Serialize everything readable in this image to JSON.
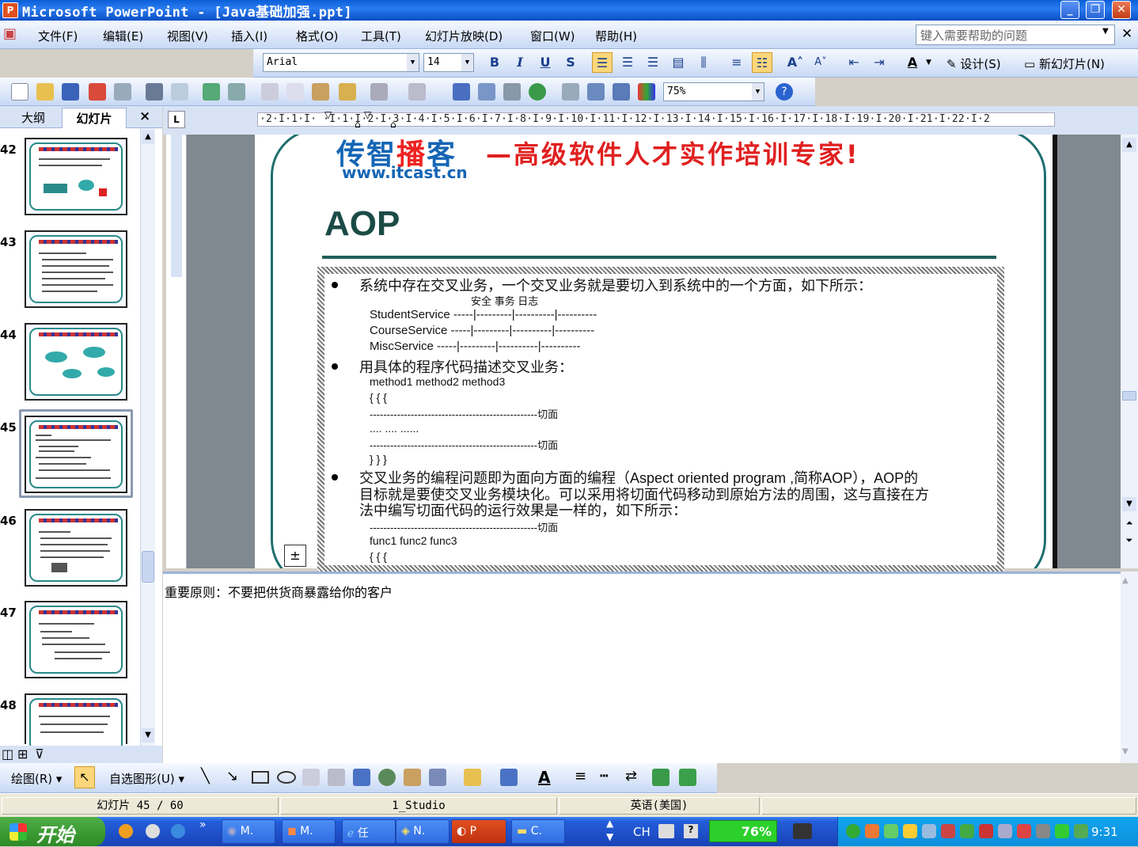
{
  "window": {
    "title": "Microsoft PowerPoint - [Java基础加强.ppt]",
    "app_icon": "powerpoint-icon"
  },
  "menu": {
    "items": [
      "文件(F)",
      "编辑(E)",
      "视图(V)",
      "插入(I)",
      "格式(O)",
      "工具(T)",
      "幻灯片放映(D)",
      "窗口(W)",
      "帮助(H)"
    ],
    "help_placeholder": "键入需要帮助的问题"
  },
  "format_toolbar": {
    "font": "Arial",
    "size": "14",
    "design_label": "设计(S)",
    "new_slide_label": "新幻灯片(N)"
  },
  "standard_toolbar": {
    "zoom": "75%"
  },
  "pane": {
    "tab_outline": "大纲",
    "tab_slides": "幻灯片",
    "close": "×",
    "thumbs": [
      {
        "num": "42"
      },
      {
        "num": "43"
      },
      {
        "num": "44"
      },
      {
        "num": "45",
        "selected": true
      },
      {
        "num": "46"
      },
      {
        "num": "47"
      },
      {
        "num": "48"
      }
    ]
  },
  "ruler": {
    "marks": "·2·I·1·I·  ·I·1·I·2·I·3·I·4·I·5·I·6·I·7·I·8·I·9·I·10·I·11·I·12·I·13·I·14·I·15·I·16·I·17·I·18·I·19·I·20·I·21·I·22·I·2"
  },
  "slide": {
    "brand": {
      "c1": "传智",
      "c2": "播",
      "c3": "客",
      "url": "www.itcast.cn"
    },
    "slogan": "—高级软件人才实作培训专家!",
    "title": "AOP",
    "bullets": [
      "系统中存在交叉业务，一个交叉业务就是要切入到系统中的一个方面，如下所示：",
      "用具体的程序代码描述交叉业务：",
      "交叉业务的编程问题即为面向方面的编程（Aspect oriented program ,简称AOP），AOP的",
      "目标就是要使交叉业务模块化。可以采用将切面代码移动到原始方法的周围，这与直接在方",
      "法中编写切面代码的运行效果是一样的，如下所示："
    ],
    "cols_header": "安全       事务        日志",
    "services": [
      "StudentService  -----|---------|----------|----------",
      "CourseService   -----|---------|----------|----------",
      "MiscService      -----|---------|----------|----------"
    ],
    "methods": "method1          method2          method3",
    "braces_open": "{                      {                       {",
    "cut_line": "-------------------------------------------------切面",
    "dots": "....             ....                ......",
    "braces_close": "}                      }                       }",
    "funcs": "func1          func2           func3",
    "braces3": "{              {                 {"
  },
  "notes": {
    "text": "重要原则：不要把供货商暴露给你的客户"
  },
  "drawing_toolbar": {
    "draw_label": "绘图(R)",
    "autoshape_label": "自选图形(U)"
  },
  "status": {
    "slide": "幻灯片 45 / 60",
    "design": "1_Studio",
    "lang": "英语(美国)"
  },
  "taskbar": {
    "start": "开始",
    "tasks": [
      "M.",
      "M.",
      "任",
      "N.",
      "P",
      "C."
    ],
    "lang": "CH",
    "battery": "76%",
    "clock": "9:31"
  },
  "colors": {
    "title_blue": "#0a5fd8",
    "slogan_red": "#e02020",
    "aop_green": "#1b4b46"
  }
}
